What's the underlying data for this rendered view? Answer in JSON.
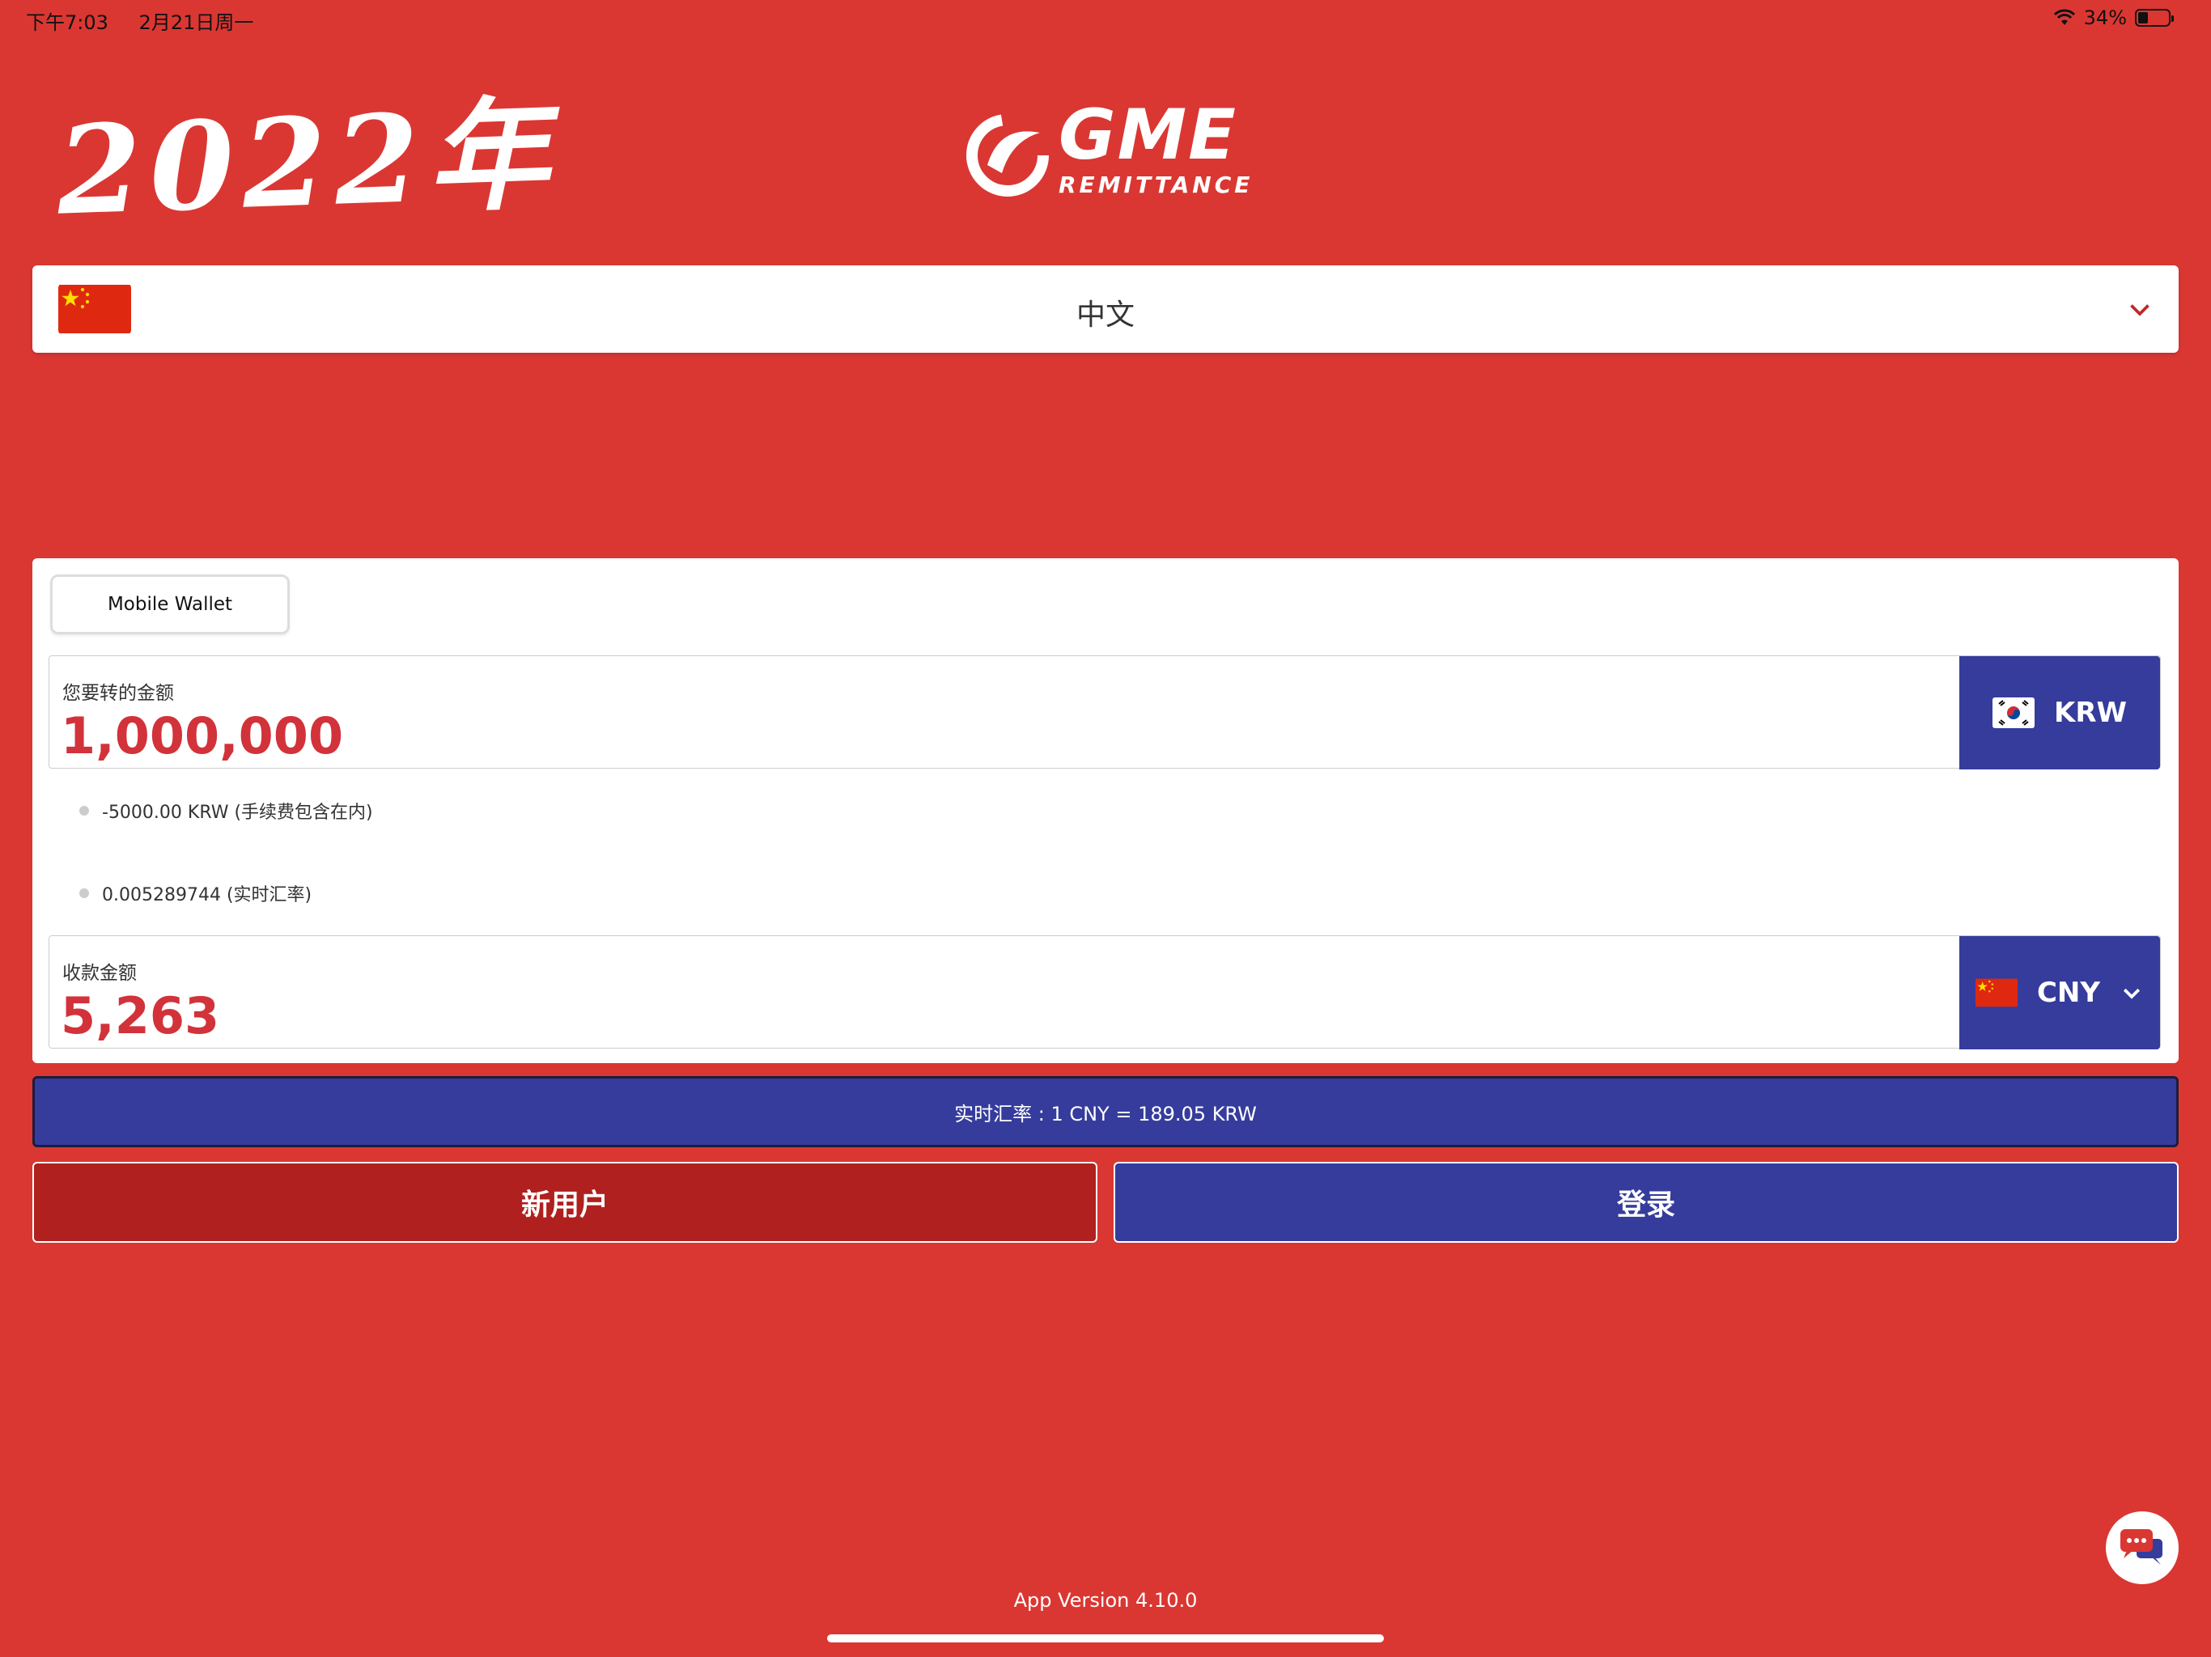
{
  "status_bar": {
    "time": "下午7:03",
    "date": "2月21日周一",
    "battery_pct": "34%",
    "battery_level": 0.34
  },
  "handwriting": "2022年",
  "logo": {
    "title": "GME",
    "subtitle": "REMITTANCE"
  },
  "language": {
    "selected": "中文",
    "flag_icon": "china-flag-icon"
  },
  "tabs": {
    "mobile_wallet": "Mobile Wallet"
  },
  "send": {
    "label": "您要转的金额",
    "amount": "1,000,000",
    "currency": "KRW"
  },
  "fee_line": "-5000.00 KRW (手续费包含在内)",
  "rate_line": "0.005289744 (实时汇率)",
  "receive": {
    "label": "收款金额",
    "amount": "5,263",
    "currency": "CNY"
  },
  "rate_bar": "实时汇率 : 1 CNY = 189.05 KRW",
  "buttons": {
    "new_user": "新用户",
    "login": "登录"
  },
  "footer": {
    "version": "App Version  4.10.0"
  },
  "colors": {
    "background": "#DA3733",
    "accent_blue": "#353C9C",
    "new_user_red": "#B0201E",
    "amount_red": "#D2323A"
  }
}
